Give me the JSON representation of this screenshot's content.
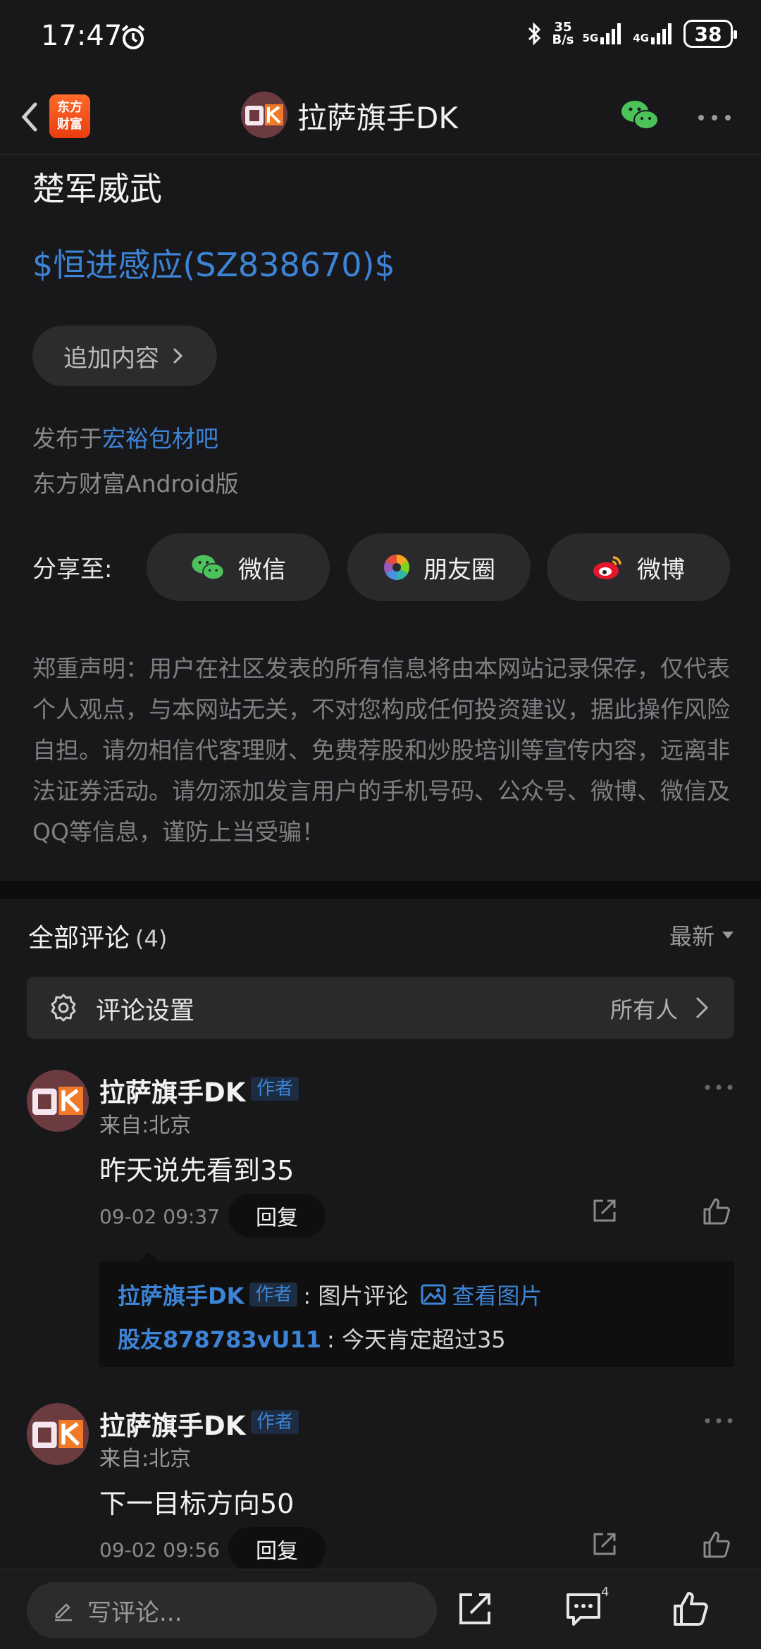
{
  "status": {
    "time": "17:47",
    "speed_top": "35",
    "speed_bottom": "B/s",
    "net1": "5G",
    "net2": "4G",
    "battery": "38"
  },
  "header": {
    "logo_line1": "东方",
    "logo_line2": "财富",
    "title": "拉萨旗手DK"
  },
  "post": {
    "tail_text": "楚军威武",
    "stock_link": "$恒进感应(SZ838670)$",
    "append_label": "追加内容",
    "published_prefix": "发布于",
    "published_bar": "宏裕包材吧",
    "client": "东方财富Android版",
    "share_label": "分享至:",
    "share_wechat": "微信",
    "share_moments": "朋友圈",
    "share_weibo": "微博",
    "disclaimer": "郑重声明：用户在社区发表的所有信息将由本网站记录保存，仅代表个人观点，与本网站无关，不对您构成任何投资建议，据此操作风险自担。请勿相信代客理财、免费荐股和炒股培训等宣传内容，远离非法证券活动。请勿添加发言用户的手机号码、公众号、微博、微信及QQ等信息，谨防上当受骗！"
  },
  "comments": {
    "title": "全部评论",
    "count": "(4)",
    "sort": "最新",
    "settings_label": "评论设置",
    "settings_value": "所有人",
    "items": [
      {
        "name": "拉萨旗手DK",
        "badge": "作者",
        "location": "来自:北京",
        "text": "昨天说先看到35",
        "time": "09-02 09:37",
        "reply": "回复",
        "sub": [
          {
            "who": "拉萨旗手DK",
            "badge": "作者",
            "text": ": 图片评论",
            "link": "查看图片"
          },
          {
            "who": "股友878783vU11",
            "text": ": 今天肯定超过35"
          }
        ]
      },
      {
        "name": "拉萨旗手DK",
        "badge": "作者",
        "location": "来自:北京",
        "text": "下一目标方向50",
        "time": "09-02 09:56",
        "reply": "回复"
      }
    ]
  },
  "bottom": {
    "write_placeholder": "写评论...",
    "comment_count": "4"
  },
  "colors": {
    "background": "#18181a",
    "link": "#3d84d6",
    "panel": "#2a2a2c",
    "brand": "#f24c12"
  }
}
